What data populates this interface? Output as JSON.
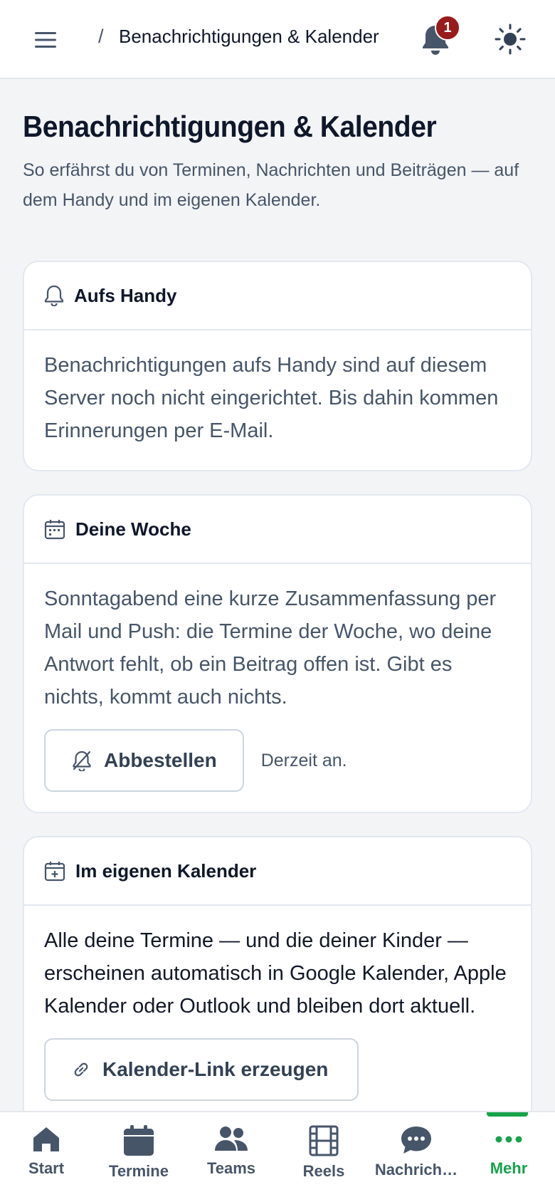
{
  "header": {
    "breadcrumb_sep": "/",
    "breadcrumb_title": "Benachrichtigungen & Kalender",
    "notification_count": "1"
  },
  "page": {
    "title": "Benachrichtigungen & Kalender",
    "subtitle": "So erfährst du von Terminen, Nachrichten und Beiträgen — auf dem Handy und im eigenen Kalender."
  },
  "cards": {
    "phone": {
      "title": "Aufs Handy",
      "text": "Benachrichtigungen aufs Handy sind auf diesem Server noch nicht eingerichtet. Bis dahin kommen Erinnerungen per E-Mail."
    },
    "week": {
      "title": "Deine Woche",
      "text": "Sonntagabend eine kurze Zusammenfassung per Mail und Push: die Termine der Woche, wo deine Antwort fehlt, ob ein Beitrag offen ist. Gibt es nichts, kommt auch nichts.",
      "button_label": "Abbestellen",
      "status": "Derzeit an."
    },
    "calendar": {
      "title": "Im eigenen Kalender",
      "text": "Alle deine Termine — und die deiner Kinder — erscheinen automatisch in Google Kalender, Apple Kalender oder Outlook und bleiben dort aktuell.",
      "button_label": "Kalender-Link erzeugen"
    }
  },
  "nav": {
    "items": [
      {
        "label": "Start",
        "icon": "home-icon"
      },
      {
        "label": "Termine",
        "icon": "calendar-icon"
      },
      {
        "label": "Teams",
        "icon": "users-icon"
      },
      {
        "label": "Reels",
        "icon": "film-icon"
      },
      {
        "label": "Nachrich…",
        "icon": "chat-icon"
      },
      {
        "label": "Mehr",
        "icon": "more-icon",
        "active": true
      }
    ]
  },
  "colors": {
    "accent": "#16a34a",
    "badge": "#991b1b",
    "text": "#0f172a",
    "muted": "#475569"
  }
}
